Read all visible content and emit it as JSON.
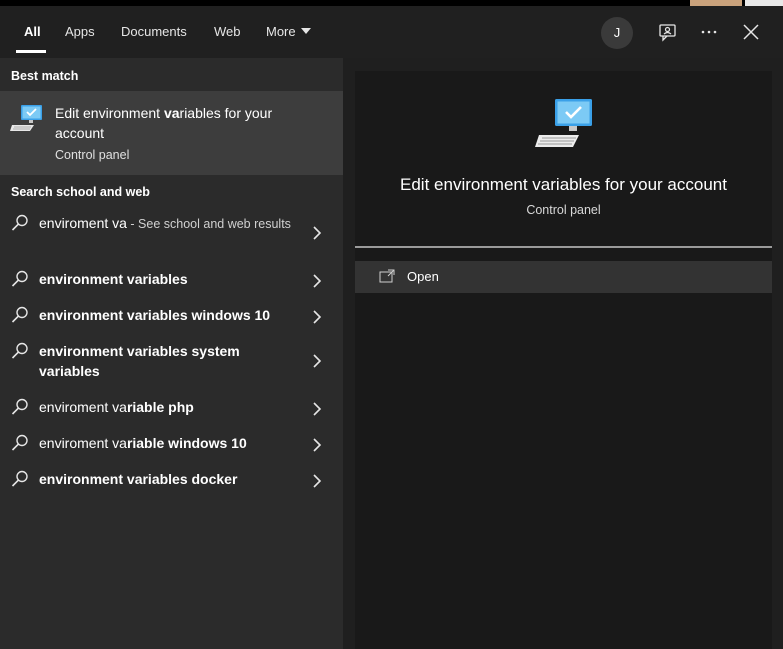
{
  "header": {
    "tabs": [
      {
        "label": "All",
        "active": true
      },
      {
        "label": "Apps"
      },
      {
        "label": "Documents"
      },
      {
        "label": "Web"
      },
      {
        "label": "More"
      }
    ],
    "avatar_initial": "J",
    "icons": [
      "feedback-icon",
      "more-options-icon",
      "close-icon"
    ]
  },
  "left": {
    "best_match_label": "Best match",
    "best_match": {
      "title_pre": "Edit environment ",
      "title_bold": "va",
      "title_post": "riables for your account",
      "subtitle": "Control panel",
      "icon": "computer-settings-icon"
    },
    "web_section_label": "Search school and web",
    "suggestions": [
      {
        "pre": "enviroment va",
        "bold": "",
        "post": "",
        "hint": " - See school and web results"
      },
      {
        "pre": "",
        "bold": "environment variables",
        "post": "",
        "hint": ""
      },
      {
        "pre": "",
        "bold": "environment variables windows 10",
        "post": "",
        "hint": ""
      },
      {
        "pre": "",
        "bold": "environment variables system variables",
        "post": "",
        "hint": ""
      },
      {
        "pre": "enviroment va",
        "bold": "riable php",
        "post": "",
        "hint": ""
      },
      {
        "pre": "enviroment va",
        "bold": "riable windows 10",
        "post": "",
        "hint": ""
      },
      {
        "pre": "",
        "bold": "environment variables docker",
        "post": "",
        "hint": ""
      }
    ]
  },
  "right": {
    "title": "Edit environment variables for your account",
    "subtitle": "Control panel",
    "open_label": "Open"
  },
  "colors": {
    "accent_blue": "#3aa0e8",
    "left_bg": "#2b2b2b",
    "right_bg": "#191919",
    "selected_bg": "#3d3d3d"
  }
}
